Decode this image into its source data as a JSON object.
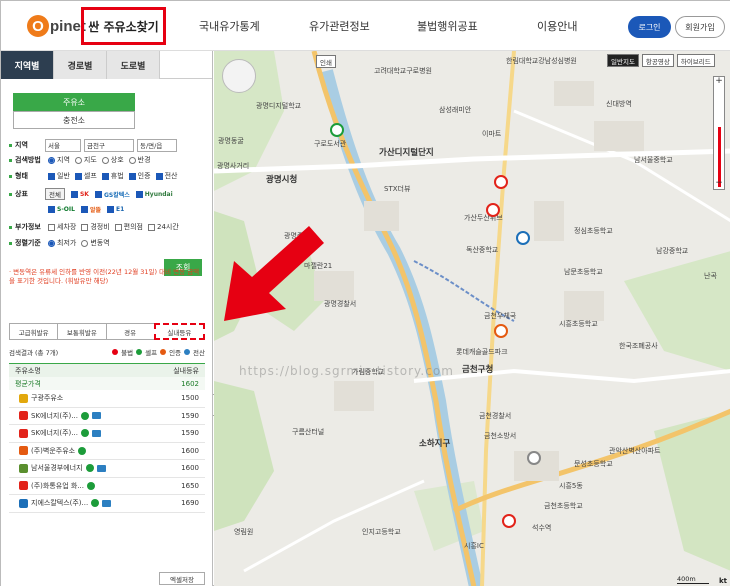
{
  "header": {
    "logo_letter": "O",
    "logo_text": "pinet",
    "nav": [
      {
        "label": "싼 주유소찾기"
      },
      {
        "label": "국내유가통계"
      },
      {
        "label": "유가관련정보"
      },
      {
        "label": "불법행위공표"
      },
      {
        "label": "이용안내"
      }
    ],
    "login": "로그인",
    "join": "회원가입"
  },
  "panel": {
    "tabs": [
      "지역별",
      "경로별",
      "도로별"
    ],
    "station_btn": "주유소",
    "charger_btn": "충전소",
    "region_label": "지역",
    "region_values": [
      "서울",
      "금천구",
      "동/면/읍"
    ],
    "search_method_label": "검색방법",
    "search_methods": [
      "지역",
      "지도",
      "상호",
      "반경"
    ],
    "type_label": "형태",
    "types": [
      "일반",
      "셀프",
      "휴법",
      "인증",
      "전산"
    ],
    "brand_label": "상표",
    "brand_all": "전체",
    "brands": [
      "SK",
      "GS칼텍스",
      "Hyundai",
      "S-OIL",
      "알뜰",
      "E1"
    ],
    "extra_label": "부가정보",
    "extras": [
      "세차장",
      "경정비",
      "편의점",
      "24시간"
    ],
    "sort_label": "정렬기준",
    "sorts": [
      "최저가",
      "변동역"
    ],
    "search_button": "조회",
    "notice": "· 변동역은 유류세 인하를 반영 이전(22년 12월 31일) 대비 변동 금액을 표기한 것입니다. (휘발유만 해당)",
    "fuel_tabs": [
      "고급휘발유",
      "보통휘발유",
      "경유",
      "실내등유"
    ],
    "result_count": "검색결과 (총 7개)",
    "legend": [
      "불법",
      "셀프",
      "인증",
      "전산"
    ],
    "table_header_name": "주유소명",
    "table_header_fuel": "실내등유",
    "avg_label": "평균가격",
    "avg_value": "1602",
    "rows": [
      {
        "name": "구광주유소",
        "price": "1500"
      },
      {
        "name": "SK에너지(주)...",
        "price": "1590"
      },
      {
        "name": "SK에너지(주)...",
        "price": "1590"
      },
      {
        "name": "(주)벽운주유소",
        "price": "1600"
      },
      {
        "name": "남서울경부에너지",
        "price": "1600"
      },
      {
        "name": "(주)화통유업 화...",
        "price": "1650"
      },
      {
        "name": "지에스칼텍스(주)...",
        "price": "1690"
      }
    ],
    "excel_button": "엑셀저장",
    "collapse": "‹"
  },
  "map": {
    "toolbar": [
      "일반지도",
      "항공영상",
      "하이브리드"
    ],
    "badge": "인쇄",
    "labels": [
      "고려대학교구로병원",
      "한림대학교강남성심병원",
      "광명디지털학교",
      "구로도서관",
      "광명동굴",
      "삼성래미안",
      "남서울중학교",
      "가산디지털단지",
      "신대방역",
      "광명사거리",
      "STX더뷰",
      "이마트",
      "광명시청",
      "가산두산위브",
      "정심초등학교",
      "광명중학교",
      "마젤란21",
      "광명경찰서",
      "독산중학교",
      "남강중학교",
      "금천우체국",
      "금천구청",
      "롯데캐슬골드파크",
      "남문초등학교",
      "한국조폐공사",
      "시흥초등학교",
      "가림중학교",
      "문성초등학교",
      "금천소방서",
      "관악산벽산아파트",
      "구름산터널",
      "소하지구",
      "금천경찰서",
      "시흥5동",
      "금천초등학교",
      "영림원",
      "인지고등학교",
      "난곡",
      "시흥IC",
      "석수역"
    ],
    "watermark": "https://blog.sgrmin.tistory.com",
    "scale": "400m",
    "provider": "kt"
  },
  "colors": {
    "accent": "#1b58b8",
    "green": "#39a848",
    "red_highlight": "#e60012",
    "notice": "#e03c1f",
    "logo_orange": "#ef7b1a"
  }
}
